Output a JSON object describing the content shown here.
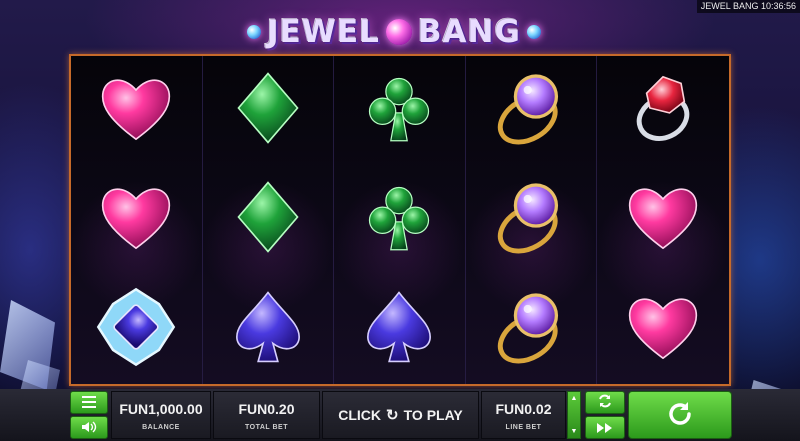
{
  "game": {
    "logo_text_left": "JEWEL",
    "logo_text_right": "BANG",
    "clock": "JEWEL BANG 10:36:56"
  },
  "reels": [
    [
      "heart",
      "heart",
      "sapphire-brooch"
    ],
    [
      "diamond-suit",
      "diamond-suit",
      "spade"
    ],
    [
      "club",
      "club",
      "spade"
    ],
    [
      "amethyst-ring",
      "amethyst-ring",
      "amethyst-ring"
    ],
    [
      "ruby-ring",
      "heart",
      "heart"
    ]
  ],
  "controls": {
    "menu_icon": "menu-icon",
    "sound_icon": "speaker-icon",
    "balance_value": "FUN1,000.00",
    "balance_label": "BALANCE",
    "total_bet_value": "FUN0.20",
    "total_bet_label": "TOTAL BET",
    "play_text_left": "CLICK",
    "play_text_right": "TO PLAY",
    "line_bet_value": "FUN0.02",
    "line_bet_label": "LINE BET",
    "autoplay_icon": "autoplay-icon",
    "turbo_icon": "fast-forward-icon",
    "spin_icon": "spin-icon"
  },
  "colors": {
    "frame": "#c66a2a",
    "button_green": "#4bbf2e",
    "heart": "#ff3aa0",
    "emerald": "#1fa33a",
    "sapphire": "#4a3ae0",
    "amethyst": "#b47cff",
    "ruby": "#e8253f",
    "gold": "#d9a53c"
  }
}
